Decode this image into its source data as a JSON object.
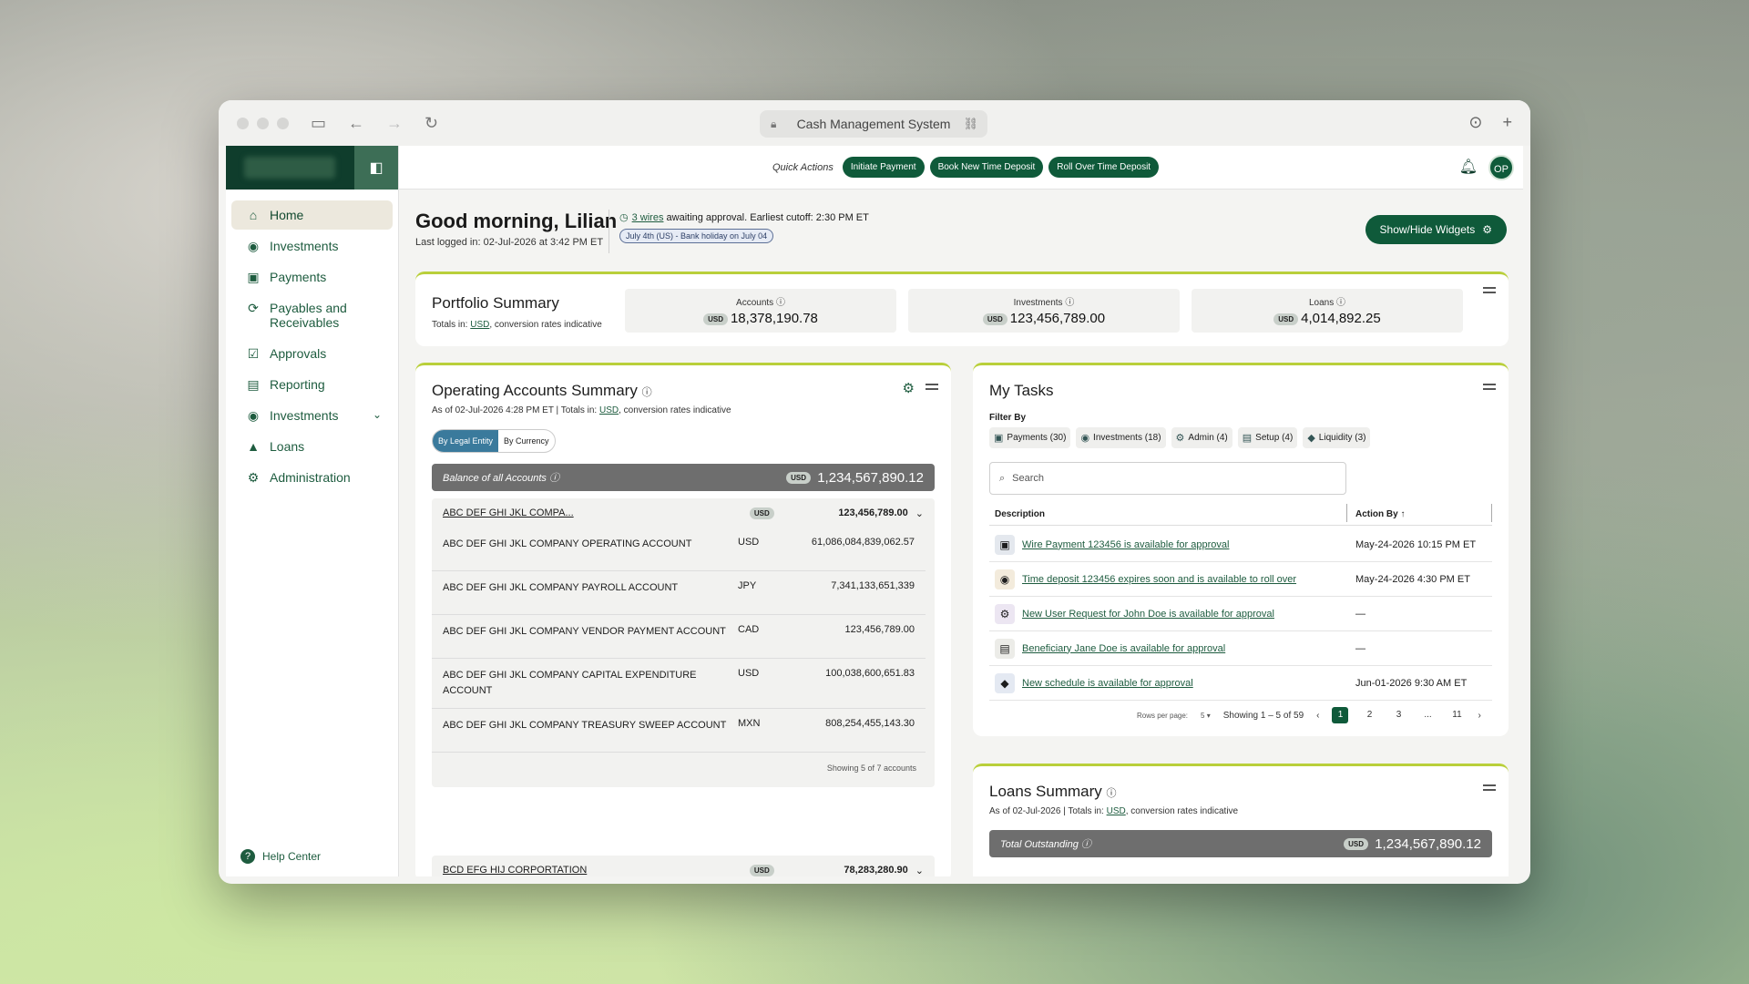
{
  "browser": {
    "url_title": "Cash Management System"
  },
  "topbar": {
    "quick_actions_label": "Quick Actions",
    "actions": [
      "Initiate Payment",
      "Book New Time Deposit",
      "Roll Over Time Deposit"
    ],
    "avatar": "OP"
  },
  "sidebar": {
    "items": [
      {
        "label": "Home",
        "icon": "home-icon"
      },
      {
        "label": "Investments",
        "icon": "piggy-bank-icon"
      },
      {
        "label": "Payments",
        "icon": "payment-icon"
      },
      {
        "label": "Payables and Receivables",
        "icon": "exchange-icon"
      },
      {
        "label": "Approvals",
        "icon": "approval-icon"
      },
      {
        "label": "Reporting",
        "icon": "report-icon"
      },
      {
        "label": "Investments",
        "icon": "piggy-bank-icon"
      },
      {
        "label": "Loans",
        "icon": "loan-icon"
      },
      {
        "label": "Administration",
        "icon": "admin-icon"
      }
    ],
    "help": "Help Center"
  },
  "header": {
    "greeting": "Good morning, Lilian",
    "last_login": "Last logged in: 02-Jul-2026 at 3:42 PM ET",
    "wires_link": "3 wires",
    "wires_text": " awaiting approval. Earliest cutoff: 2:30 PM ET",
    "holiday": "July 4th (US) - Bank holiday on July 04",
    "show_hide": "Show/Hide Widgets"
  },
  "portfolio": {
    "title": "Portfolio Summary",
    "totals_prefix": "Totals in: ",
    "totals_ccy": "USD",
    "totals_suffix": ", conversion rates indicative",
    "usd": "USD",
    "metrics": [
      {
        "label": "Accounts",
        "value": "18,378,190.78"
      },
      {
        "label": "Investments",
        "value": "123,456,789.00"
      },
      {
        "label": "Loans",
        "value": "4,014,892.25"
      }
    ]
  },
  "operating": {
    "title": "Operating Accounts Summary",
    "as_of_prefix": "As of 02-Jul-2026 4:28 PM ET | Totals in: ",
    "ccy": "USD",
    "as_of_suffix": ", conversion rates indicative",
    "seg_entity": "By Legal Entity",
    "seg_currency": "By Currency",
    "balance_label": "Balance of all Accounts",
    "balance_value": "1,234,567,890.12",
    "usd": "USD",
    "group1": {
      "name": "ABC DEF GHI JKL COMPA...",
      "total": "123,456,789.00",
      "rows": [
        {
          "name": "ABC DEF GHI JKL COMPANY OPERATING ACCOUNT",
          "ccy": "USD",
          "value": "61,086,084,839,062.57"
        },
        {
          "name": "ABC DEF GHI JKL COMPANY PAYROLL ACCOUNT",
          "ccy": "JPY",
          "value": "7,341,133,651,339"
        },
        {
          "name": "ABC DEF GHI JKL COMPANY VENDOR PAYMENT ACCOUNT",
          "ccy": "CAD",
          "value": "123,456,789.00"
        },
        {
          "name": "ABC DEF GHI JKL COMPANY CAPITAL EXPENDITURE ACCOUNT",
          "ccy": "USD",
          "value": "100,038,600,651.83"
        },
        {
          "name": "ABC DEF GHI JKL COMPANY TREASURY SWEEP ACCOUNT",
          "ccy": "MXN",
          "value": "808,254,455,143.30"
        }
      ],
      "footer": "Showing 5 of 7 accounts"
    },
    "group2": {
      "name": "BCD EFG HIJ CORPORTATION",
      "total": "78,283,280.90"
    }
  },
  "tasks": {
    "title": "My Tasks",
    "filter_by": "Filter By",
    "chips": [
      {
        "label": "Payments (30)",
        "icon": "payment-icon"
      },
      {
        "label": "Investments (18)",
        "icon": "piggy-bank-icon"
      },
      {
        "label": "Admin (4)",
        "icon": "admin-icon"
      },
      {
        "label": "Setup (4)",
        "icon": "clipboard-icon"
      },
      {
        "label": "Liquidity (3)",
        "icon": "drop-icon"
      }
    ],
    "search_placeholder": "Search",
    "col_description": "Description",
    "col_action_by": "Action By",
    "rows": [
      {
        "desc": "Wire Payment 123456 is available for approval",
        "when": "May-24-2026 10:15 PM ET",
        "icon": "payment-icon"
      },
      {
        "desc": "Time deposit 123456 expires soon and is available to roll over",
        "when": "May-24-2026 4:30 PM ET",
        "icon": "piggy-bank-icon"
      },
      {
        "desc": "New User Request for John Doe is available for approval",
        "when": "—",
        "icon": "admin-icon"
      },
      {
        "desc": "Beneficiary Jane Doe is available for approval",
        "when": "—",
        "icon": "clipboard-icon"
      },
      {
        "desc": "New schedule is available for approval",
        "when": "Jun-01-2026 9:30 AM ET",
        "icon": "drop-icon"
      }
    ],
    "rows_per_page_label": "Rows per page:",
    "rows_per_page": "5",
    "showing": "Showing 1 – 5 of 59",
    "pages": [
      "1",
      "2",
      "3",
      "...",
      "11"
    ]
  },
  "loans": {
    "title": "Loans Summary",
    "as_of_prefix": "As of 02-Jul-2026 | Totals in: ",
    "ccy": "USD",
    "as_of_suffix": ", conversion rates indicative",
    "total_label": "Total Outstanding",
    "total_value": "1,234,567,890.12",
    "usd": "USD"
  }
}
